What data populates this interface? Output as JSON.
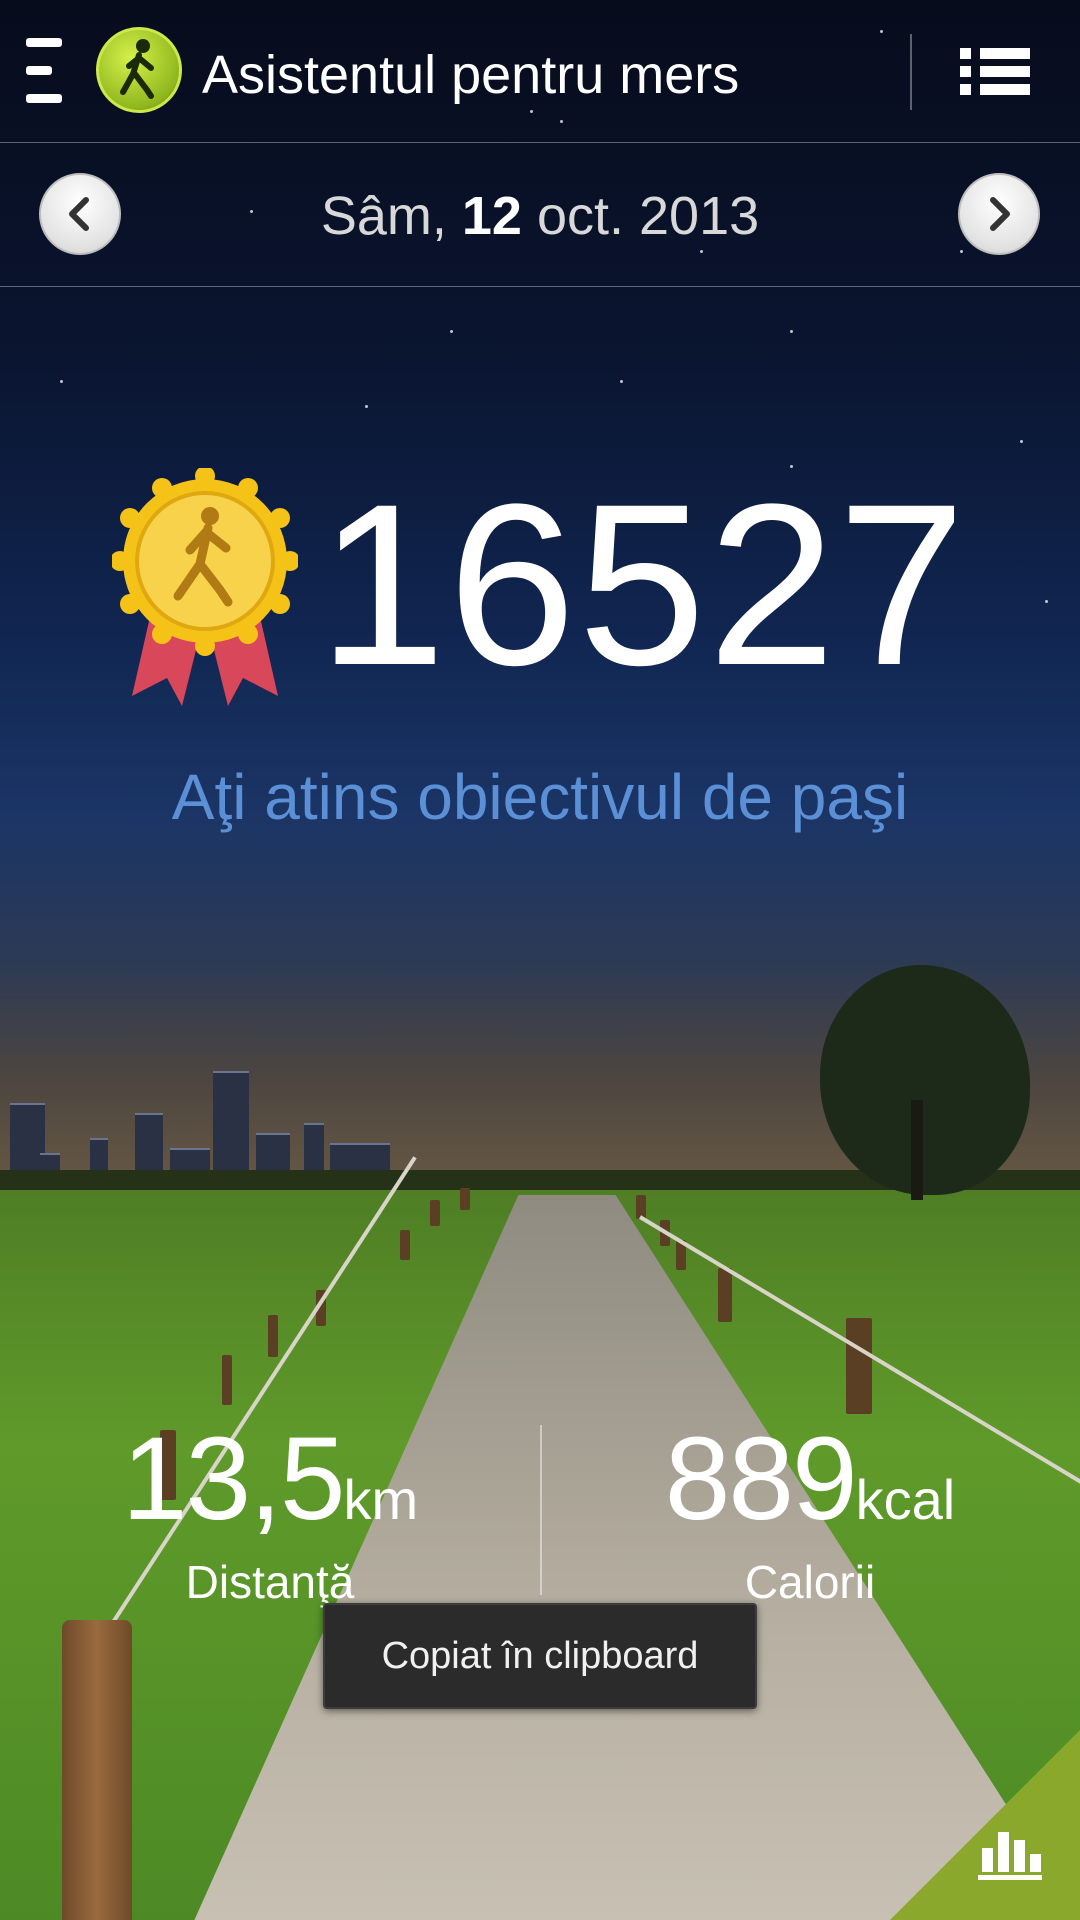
{
  "header": {
    "title": "Asistentul pentru mers",
    "menu_icon": "drawer-menu-icon",
    "logo_icon": "walker-logo-icon",
    "list_icon": "list-view-icon"
  },
  "date_bar": {
    "day": "Sâm,",
    "day_number": "12",
    "month_year": "oct. 2013",
    "prev_icon": "chevron-left-icon",
    "next_icon": "chevron-right-icon"
  },
  "steps": {
    "count": "16527",
    "goal_message": "Aţi atins obiectivul de paşi",
    "medal_icon": "goal-medal-icon"
  },
  "stats": {
    "distance": {
      "value": "13,5",
      "unit": "km",
      "label": "Distanţă"
    },
    "calories": {
      "value": "889",
      "unit": "kcal",
      "label": "Calorii"
    }
  },
  "toast": {
    "message": "Copiat în clipboard"
  },
  "chart_button": {
    "icon": "bar-chart-icon"
  },
  "colors": {
    "goal_text": "#5b8fd6",
    "chart_button": "#8aa82c",
    "logo": "#a6cc22"
  }
}
